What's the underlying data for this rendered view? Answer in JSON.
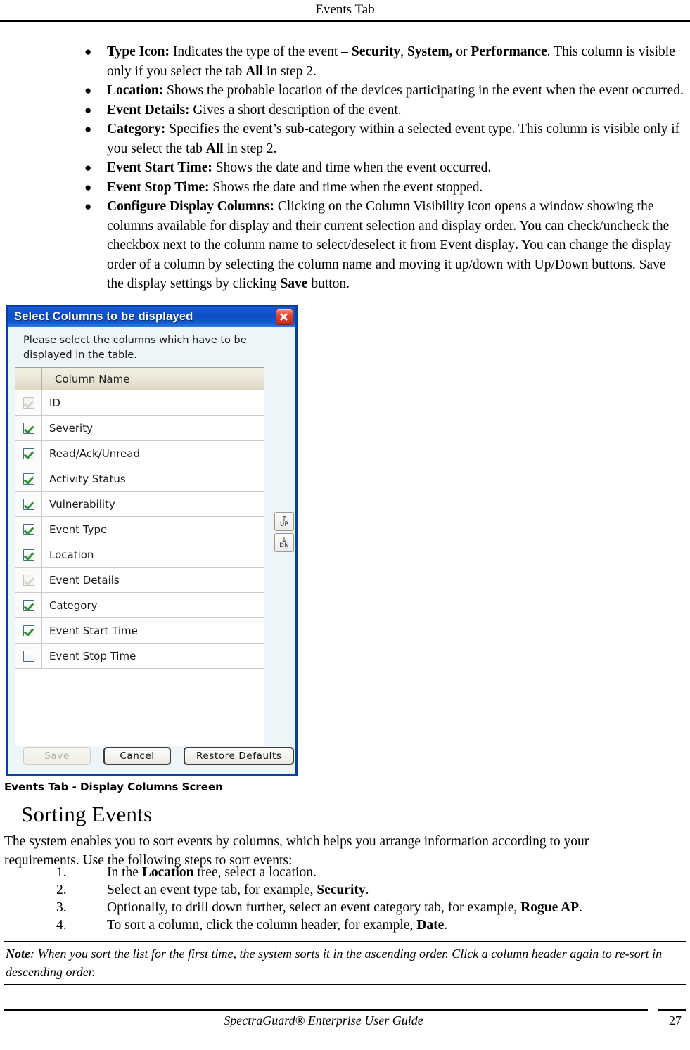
{
  "header": {
    "running_head": "Events Tab"
  },
  "bullets": [
    {
      "term": "Type Icon:",
      "parts": [
        {
          "t": " Indicates the type of the event – ",
          "b": false
        },
        {
          "t": "Security",
          "b": true
        },
        {
          "t": ", ",
          "b": false
        },
        {
          "t": "System,",
          "b": true
        },
        {
          "t": " or ",
          "b": false
        },
        {
          "t": "Performance",
          "b": true
        },
        {
          "t": ". This column is visible only if you select the tab ",
          "b": false
        },
        {
          "t": "All",
          "b": true
        },
        {
          "t": " in step 2.",
          "b": false
        }
      ]
    },
    {
      "term": "Location:",
      "parts": [
        {
          "t": " Shows the probable location of the devices participating in the event when the event occurred.",
          "b": false
        }
      ]
    },
    {
      "term": "Event Details:",
      "parts": [
        {
          "t": " Gives a short description of the event.",
          "b": false
        }
      ]
    },
    {
      "term": "Category:",
      "parts": [
        {
          "t": " Specifies the event’s sub-category within a selected event type. This column is visible only if you select the tab ",
          "b": false
        },
        {
          "t": "All",
          "b": true
        },
        {
          "t": " in step 2.",
          "b": false
        }
      ]
    },
    {
      "term": "Event Start Time:",
      "parts": [
        {
          "t": " Shows the date and time when the event occurred.",
          "b": false
        }
      ]
    },
    {
      "term": "Event Stop Time:",
      "parts": [
        {
          "t": " Shows the date and time when the event stopped.",
          "b": false
        }
      ]
    },
    {
      "term": "Configure Display Columns:",
      "parts": [
        {
          "t": " Clicking on the Column Visibility icon opens a window showing the columns available for display and their current selection and display order. You can check/uncheck the checkbox next to the column name to select/deselect it from Event display",
          "b": false
        },
        {
          "t": ".",
          "b": true
        },
        {
          "t": " You can change the display order of a column by selecting the column name and moving it up/down with Up/Down buttons. Save the display settings by clicking ",
          "b": false
        },
        {
          "t": "Save",
          "b": true
        },
        {
          "t": " button.",
          "b": false
        }
      ]
    }
  ],
  "dialog": {
    "title": "Select Columns to be displayed",
    "close_icon": "close-icon",
    "instruction": "Please select the columns which have to be displayed in the table.",
    "table_header": "Column Name",
    "rows": [
      {
        "label": "ID",
        "state": "disabled-checked"
      },
      {
        "label": "Severity",
        "state": "checked"
      },
      {
        "label": "Read/Ack/Unread",
        "state": "checked"
      },
      {
        "label": "Activity Status",
        "state": "checked"
      },
      {
        "label": "Vulnerability",
        "state": "checked"
      },
      {
        "label": "Event Type",
        "state": "checked"
      },
      {
        "label": "Location",
        "state": "checked"
      },
      {
        "label": "Event Details",
        "state": "disabled-checked"
      },
      {
        "label": "Category",
        "state": "checked"
      },
      {
        "label": "Event Start Time",
        "state": "checked"
      },
      {
        "label": "Event Stop Time",
        "state": "unchecked"
      }
    ],
    "move_up": {
      "arrow": "↑",
      "label": "UP",
      "icon": "arrow-up-icon"
    },
    "move_down": {
      "arrow": "↓",
      "label": "DN",
      "icon": "arrow-down-icon"
    },
    "buttons": {
      "save": "Save",
      "cancel": "Cancel",
      "restore": "Restore Defaults"
    },
    "colors": {
      "titlebar_blue": "#0e4fc4",
      "frame_blue": "#0b3fa8",
      "close_red": "#c62d15",
      "check_green": "#2f9433",
      "body_bg": "#eef5f8",
      "header_row": "#eae6d6"
    }
  },
  "figure_caption": "Events Tab - Display Columns Screen",
  "section": {
    "heading": "Sorting Events",
    "intro": "The system enables you to sort events by columns, which helps you arrange information according to your requirements. Use the following steps to sort events:",
    "steps": [
      {
        "num": "1.",
        "parts": [
          {
            "t": "In the ",
            "b": false
          },
          {
            "t": "Location",
            "b": true
          },
          {
            "t": " tree, select a location.",
            "b": false
          }
        ]
      },
      {
        "num": "2.",
        "parts": [
          {
            "t": "Select an event type tab, for example, ",
            "b": false
          },
          {
            "t": "Security",
            "b": true
          },
          {
            "t": ".",
            "b": false
          }
        ]
      },
      {
        "num": "3.",
        "parts": [
          {
            "t": "Optionally, to drill down further, select an event category tab, for example, ",
            "b": false
          },
          {
            "t": "Rogue AP",
            "b": true
          },
          {
            "t": ".",
            "b": false
          }
        ]
      },
      {
        "num": "4.",
        "parts": [
          {
            "t": "To sort a column, click the column header, for example, ",
            "b": false
          },
          {
            "t": "Date",
            "b": true
          },
          {
            "t": ".",
            "b": false
          }
        ]
      }
    ]
  },
  "note": {
    "label": "Note",
    "text": ": When you sort the list for the first time, the system sorts it in the ascending order. Click a column header again to re-sort in descending order."
  },
  "footer": {
    "title": "SpectraGuard®  Enterprise User Guide",
    "page": "27"
  }
}
